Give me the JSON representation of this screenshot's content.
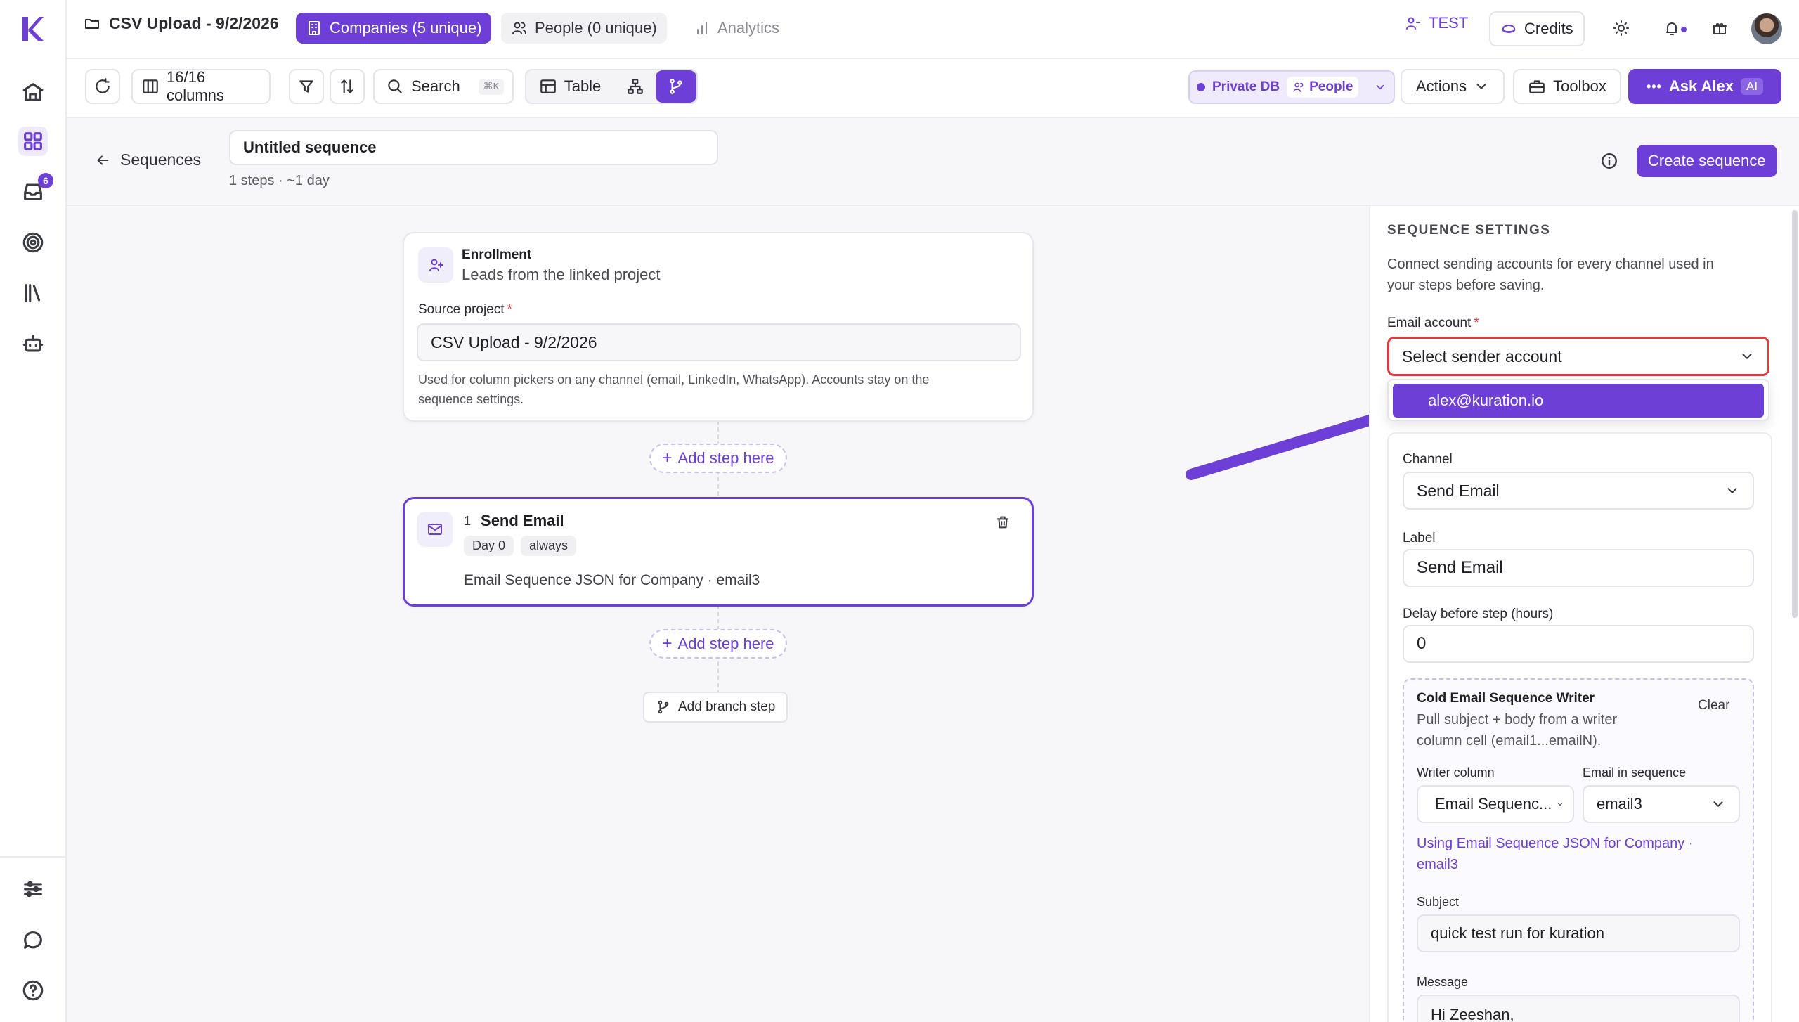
{
  "app": {
    "project_title": "CSV Upload - 9/2/2026",
    "tabs": [
      {
        "label": "Companies (5 unique)"
      },
      {
        "label": "People (0 unique)"
      },
      {
        "label": "Analytics"
      }
    ],
    "workspace": "TEST",
    "credits_label": "Credits"
  },
  "rail": {
    "inbox_badge": "6"
  },
  "toolbar": {
    "columns_label": "16/16 columns",
    "search_label": "Search",
    "search_shortcut": "⌘K",
    "table_label": "Table",
    "private_db_label": "Private DB",
    "people_label": "People",
    "actions_label": "Actions",
    "toolbox_label": "Toolbox",
    "ask_label": "Ask Alex",
    "ask_badge": "AI"
  },
  "sequence": {
    "back_label": "Sequences",
    "name": "Untitled sequence",
    "meta": "1 steps · ~1 day",
    "create_label": "Create sequence"
  },
  "canvas": {
    "enrollment": {
      "title": "Enrollment",
      "subtitle": "Leads from the linked project",
      "source_label": "Source project",
      "source_value": "CSV Upload - 9/2/2026",
      "help": "Used for column pickers on any channel (email, LinkedIn, WhatsApp). Accounts stay on the",
      "help2": "sequence settings."
    },
    "add_step_label": "Add step here",
    "step": {
      "number": "1",
      "title": "Send Email",
      "day": "Day 0",
      "condition": "always",
      "detail": "Email Sequence JSON for Company · email3"
    },
    "add_branch_label": "Add branch step"
  },
  "panel": {
    "heading": "SEQUENCE SETTINGS",
    "desc1": "Connect sending accounts for every channel used in",
    "desc2": "your steps before saving.",
    "email_account_label": "Email account",
    "email_account_placeholder": "Select sender account",
    "dropdown_option": "alex@kuration.io",
    "channel_label": "Channel",
    "channel_value": "Send Email",
    "label_label": "Label",
    "label_value": "Send Email",
    "delay_label": "Delay before step (hours)",
    "delay_value": "0",
    "writer": {
      "title": "Cold Email Sequence Writer",
      "clear_label": "Clear",
      "desc1": "Pull subject + body from a writer",
      "desc2": "column cell (email1...emailN).",
      "writer_column_label": "Writer column",
      "writer_column_value": "Email Sequenc...",
      "email_in_seq_label": "Email in sequence",
      "email_in_seq_value": "email3",
      "using1": "Using Email Sequence JSON for Company ·",
      "using2": "email3",
      "subject_label": "Subject",
      "subject_value": "quick test run for kuration",
      "message_label": "Message",
      "message_value": "Hi Zeeshan,"
    }
  },
  "colors": {
    "accent": "#6d3fd6",
    "danger": "#e0393e"
  }
}
